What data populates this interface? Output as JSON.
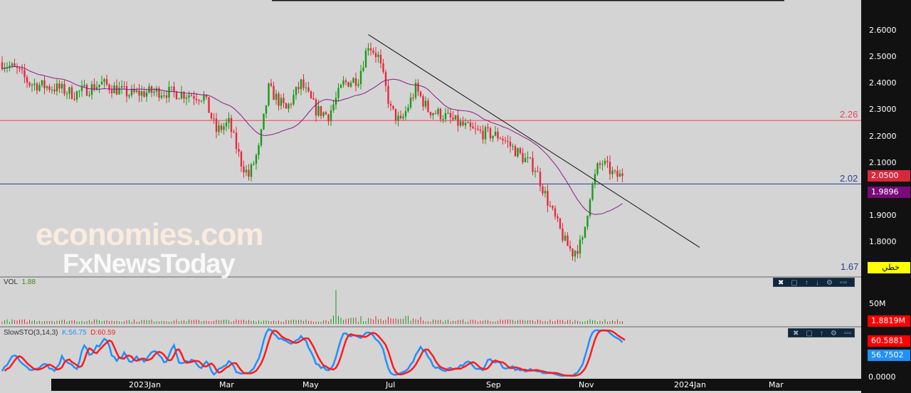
{
  "chart_data": {
    "type": "candlestick",
    "price_axis": {
      "ticks": [
        "2.6000",
        "2.5000",
        "2.4000",
        "2.3000",
        "2.2000",
        "2.1000",
        "1.9000",
        "1.8000"
      ],
      "range": [
        1.65,
        2.72
      ]
    },
    "x_ticks": [
      "2023Jan",
      "Mar",
      "May",
      "Jul",
      "Sep",
      "Nov",
      "2024Jan",
      "Mar"
    ],
    "price_path": [
      [
        0,
        2.48
      ],
      [
        6,
        2.45
      ],
      [
        11,
        2.4
      ],
      [
        23,
        2.38
      ],
      [
        29,
        2.36
      ],
      [
        40,
        2.4
      ],
      [
        51,
        2.36
      ],
      [
        63,
        2.37
      ],
      [
        74,
        2.36
      ],
      [
        81,
        2.35
      ],
      [
        86,
        2.22
      ],
      [
        91,
        2.25
      ],
      [
        96,
        2.1
      ],
      [
        99,
        2.05
      ],
      [
        103,
        2.15
      ],
      [
        107,
        2.38
      ],
      [
        114,
        2.3
      ],
      [
        120,
        2.4
      ],
      [
        126,
        2.3
      ],
      [
        131,
        2.28
      ],
      [
        137,
        2.4
      ],
      [
        143,
        2.42
      ],
      [
        147,
        2.55
      ],
      [
        151,
        2.5
      ],
      [
        156,
        2.3
      ],
      [
        160,
        2.25
      ],
      [
        166,
        2.38
      ],
      [
        171,
        2.3
      ],
      [
        177,
        2.28
      ],
      [
        189,
        2.22
      ],
      [
        200,
        2.2
      ],
      [
        209,
        2.12
      ],
      [
        214,
        2.08
      ],
      [
        220,
        1.93
      ],
      [
        226,
        1.8
      ],
      [
        229,
        1.76
      ],
      [
        233,
        1.8
      ],
      [
        236,
        1.98
      ],
      [
        239,
        2.08
      ],
      [
        241,
        2.1
      ],
      [
        246,
        2.05
      ],
      [
        249,
        2.05
      ]
    ],
    "last_price": "2.0500",
    "ma_value": "1.9896",
    "horizontal_lines": [
      {
        "label": "2.26",
        "value": 2.26,
        "color": "#e8485a"
      },
      {
        "label": "2.02",
        "value": 2.02,
        "color": "#2a3f8f"
      },
      {
        "label": "1.67",
        "value": 1.67,
        "color": "#2a3f8f"
      }
    ],
    "trendline": {
      "from": [
        147,
        2.585
      ],
      "to": [
        280,
        1.78
      ]
    },
    "volume": {
      "title": "VOL",
      "value": "1.88",
      "tick": "50M",
      "last": "1.8819M",
      "spike_index": 134
    },
    "stoch": {
      "title": "SlowSTO(3,14,3)",
      "k_label": "K:56.75",
      "d_label": "D:60.59",
      "k_last": "56.7502",
      "d_last": "60.5881",
      "tick": "0.0000"
    },
    "colors": {
      "up": "#1a9a1a",
      "down": "#e8283c",
      "ma": "#8a1a8a",
      "k": "#1e90ff",
      "d": "#ff1a1a"
    }
  },
  "badge": "خطي",
  "logo": {
    "line1": "economies.com",
    "line2": "FxNewsToday"
  }
}
